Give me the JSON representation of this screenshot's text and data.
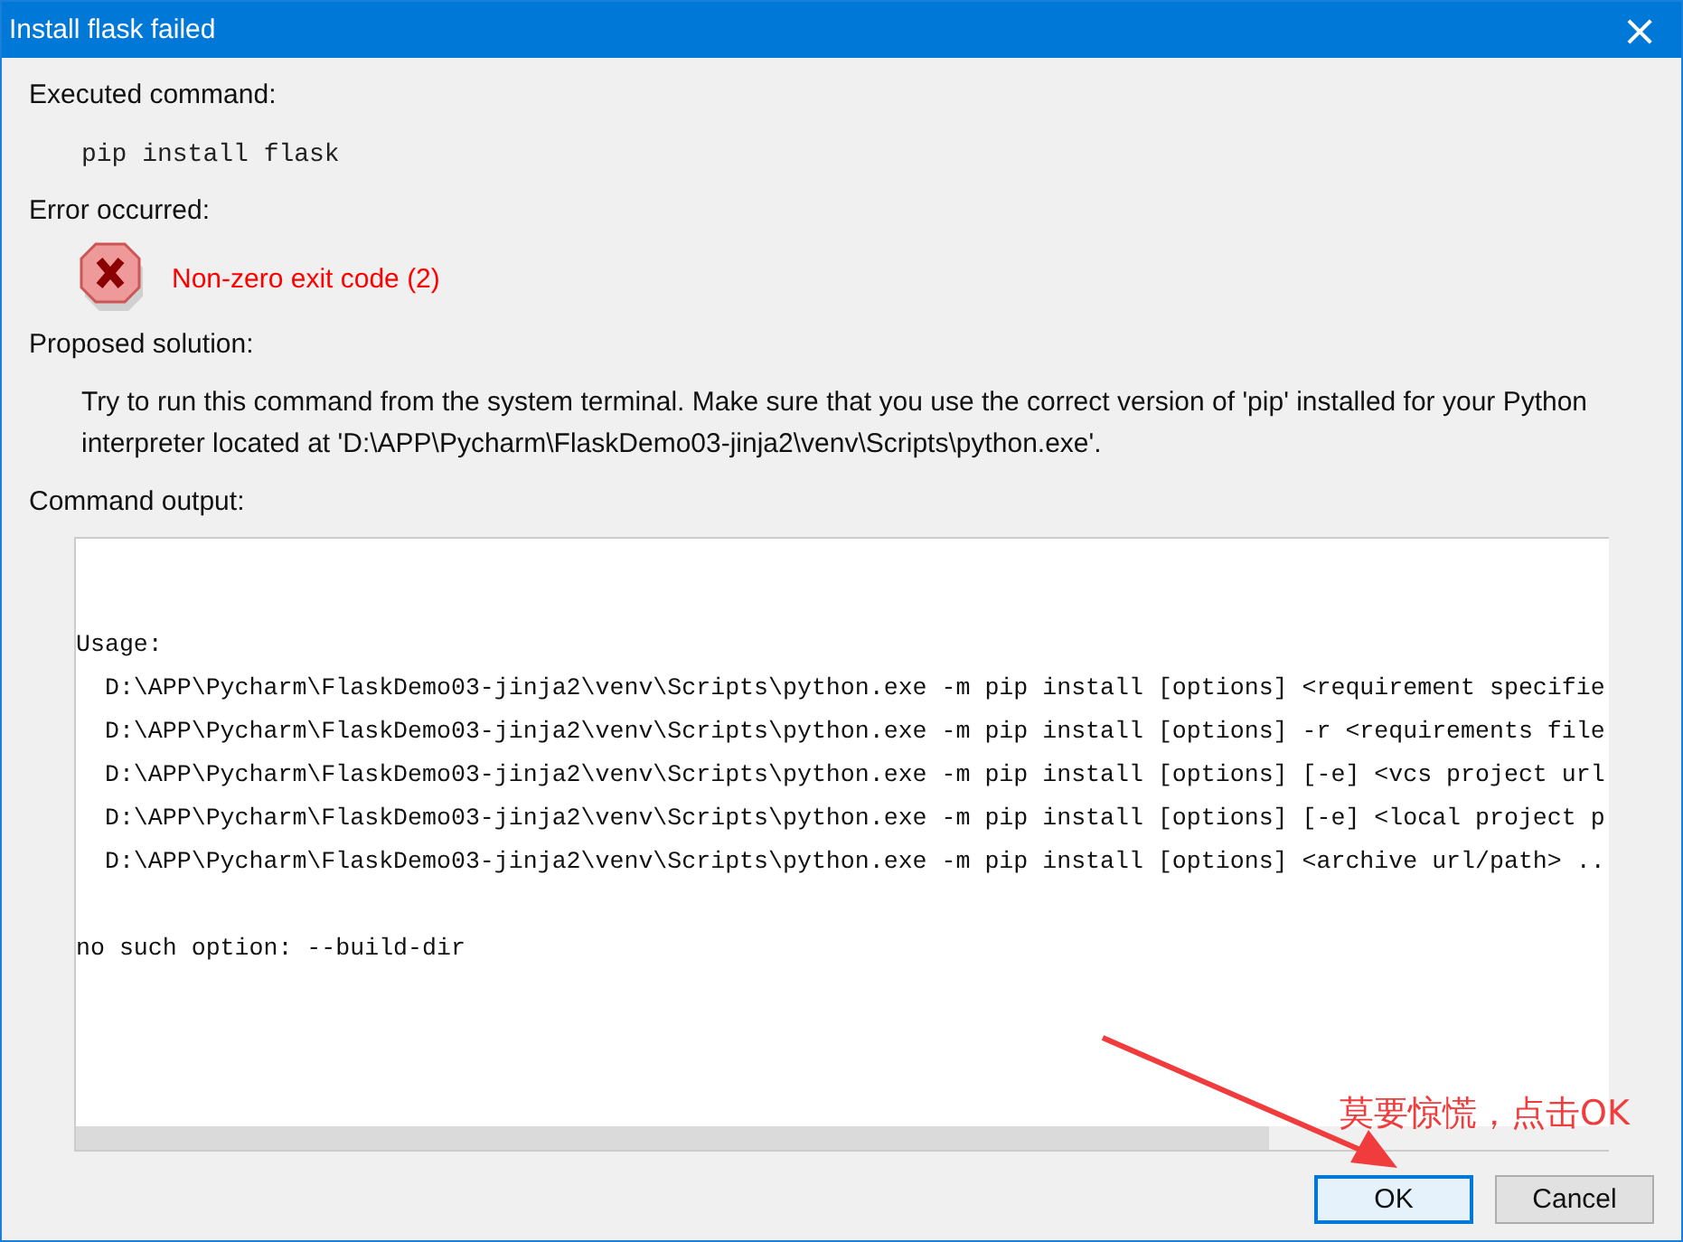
{
  "window": {
    "title": "Install flask failed",
    "close": "×"
  },
  "executed": {
    "label": "Executed command:",
    "command": "pip install flask"
  },
  "error": {
    "label": "Error occurred:",
    "message": "Non-zero exit code (2)"
  },
  "solution": {
    "label": "Proposed solution:",
    "text": "Try to run this command from the system terminal. Make sure that you use the correct version of 'pip' installed for your Python interpreter located at 'D:\\APP\\Pycharm\\FlaskDemo03-jinja2\\venv\\Scripts\\python.exe'."
  },
  "output": {
    "label": "Command output:",
    "groups": [
      [
        "Usage:",
        "  D:\\APP\\Pycharm\\FlaskDemo03-jinja2\\venv\\Scripts\\python.exe -m pip install [options] <requirement specifie",
        "  D:\\APP\\Pycharm\\FlaskDemo03-jinja2\\venv\\Scripts\\python.exe -m pip install [options] -r <requirements file",
        "  D:\\APP\\Pycharm\\FlaskDemo03-jinja2\\venv\\Scripts\\python.exe -m pip install [options] [-e] <vcs project url",
        "  D:\\APP\\Pycharm\\FlaskDemo03-jinja2\\venv\\Scripts\\python.exe -m pip install [options] [-e] <local project p",
        "  D:\\APP\\Pycharm\\FlaskDemo03-jinja2\\venv\\Scripts\\python.exe -m pip install [options] <archive url/path> .."
      ],
      [
        "no such option: --build-dir"
      ]
    ]
  },
  "buttons": [
    {
      "label": "OK",
      "default": true
    },
    {
      "label": "Cancel",
      "default": false
    }
  ],
  "annotation": {
    "text": "莫要惊慌，点击OK"
  }
}
